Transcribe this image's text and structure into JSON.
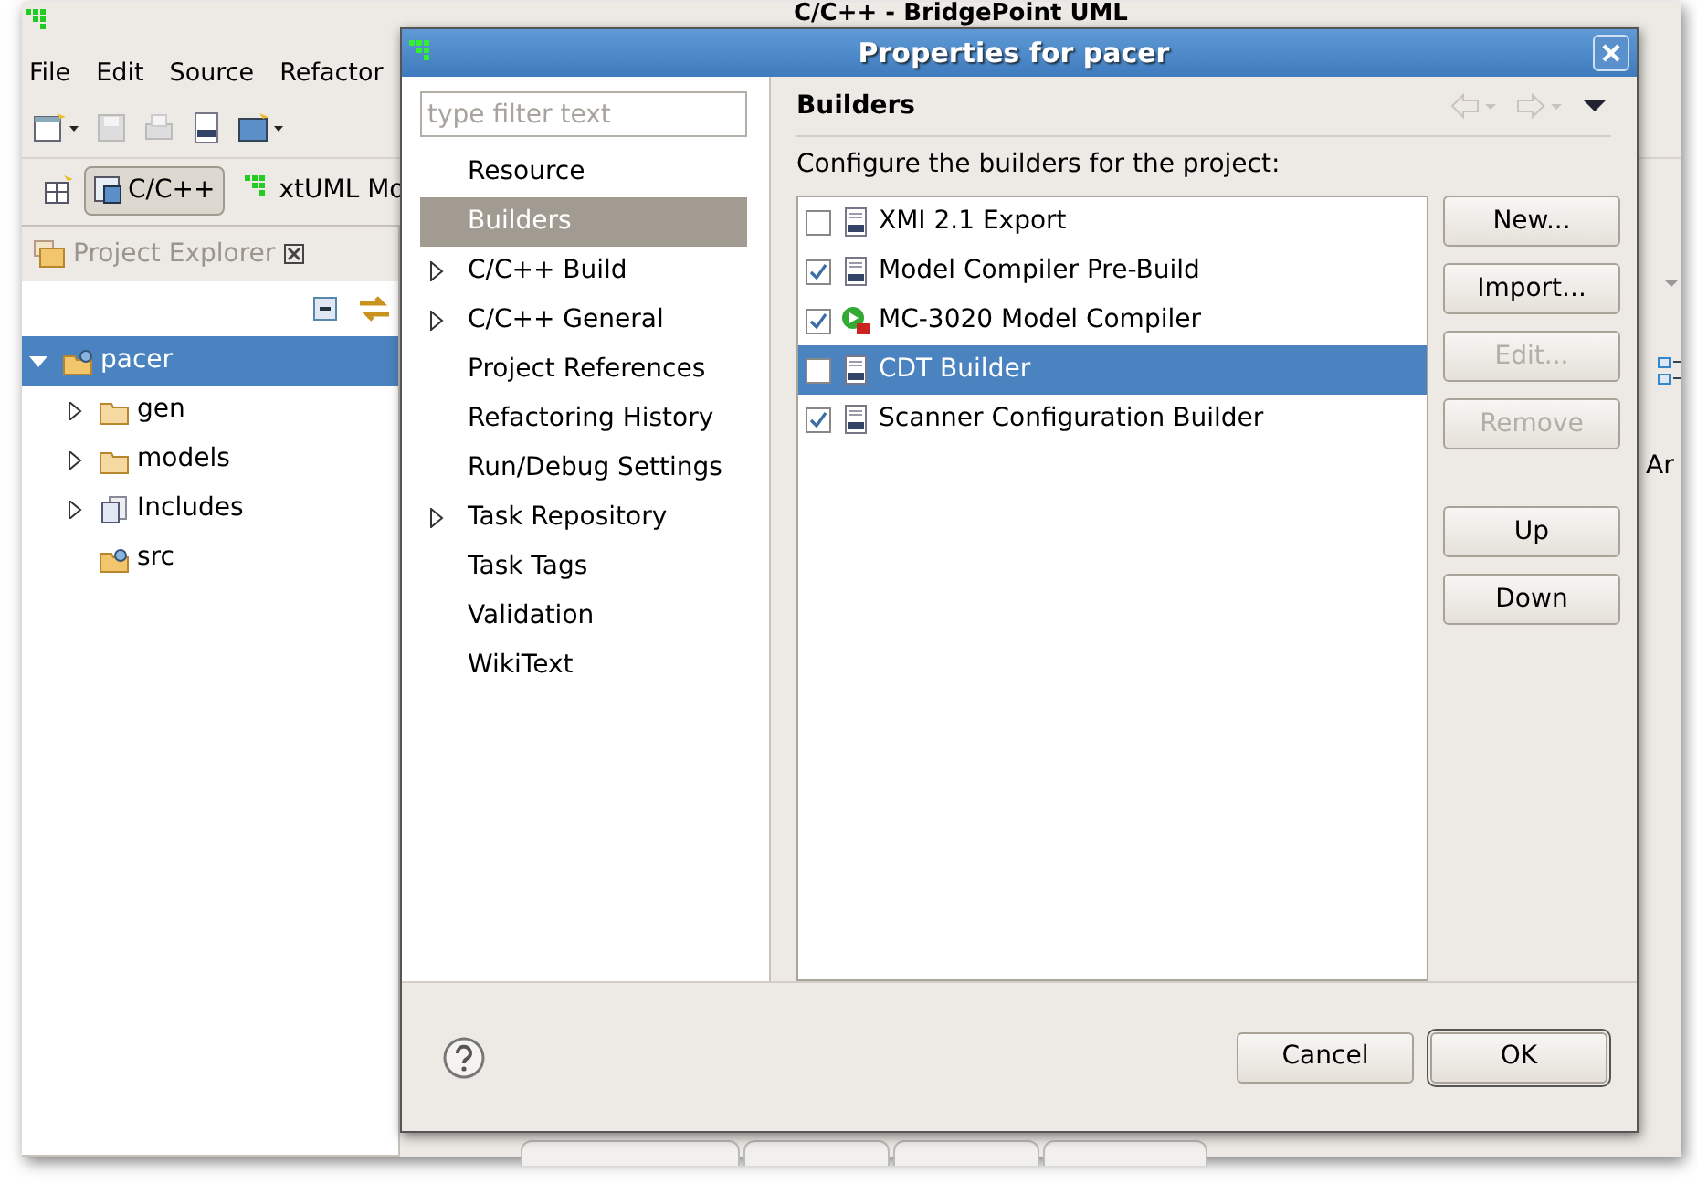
{
  "main_window": {
    "title": "C/C++ - BridgePoint UML",
    "menu": [
      "File",
      "Edit",
      "Source",
      "Refactor"
    ],
    "perspectives": [
      {
        "label": "C/C++",
        "selected": true
      },
      {
        "label": "xtUML Mo",
        "selected": false
      }
    ],
    "explorer": {
      "title": "Project Explorer",
      "tree": [
        {
          "label": "pacer",
          "kind": "project",
          "expanded": true,
          "selected": true,
          "children": [
            {
              "label": "gen",
              "kind": "folder",
              "expanded": false,
              "selected": false
            },
            {
              "label": "models",
              "kind": "folder",
              "expanded": false,
              "selected": false
            },
            {
              "label": "Includes",
              "kind": "includes",
              "expanded": false,
              "selected": false
            },
            {
              "label": "src",
              "kind": "source",
              "selected": false
            }
          ]
        }
      ]
    },
    "right_panel_text": "Ar"
  },
  "dialog": {
    "title": "Properties for pacer",
    "filter": {
      "placeholder": "type filter text"
    },
    "nav": [
      {
        "label": "Resource",
        "selected": false,
        "expandable": false
      },
      {
        "label": "Builders",
        "selected": true,
        "expandable": false
      },
      {
        "label": "C/C++ Build",
        "selected": false,
        "expandable": true
      },
      {
        "label": "C/C++ General",
        "selected": false,
        "expandable": true
      },
      {
        "label": "Project References",
        "selected": false,
        "expandable": false
      },
      {
        "label": "Refactoring History",
        "selected": false,
        "expandable": false
      },
      {
        "label": "Run/Debug Settings",
        "selected": false,
        "expandable": false
      },
      {
        "label": "Task Repository",
        "selected": false,
        "expandable": true
      },
      {
        "label": "Task Tags",
        "selected": false,
        "expandable": false
      },
      {
        "label": "Validation",
        "selected": false,
        "expandable": false
      },
      {
        "label": "WikiText",
        "selected": false,
        "expandable": false
      }
    ],
    "page_title": "Builders",
    "description": "Configure the builders for the project:",
    "builders": [
      {
        "label": "XMI 2.1 Export",
        "kind": "file",
        "checked": false,
        "selected": false
      },
      {
        "label": "Model Compiler Pre-Build",
        "kind": "file",
        "checked": true,
        "selected": false
      },
      {
        "label": "MC-3020 Model Compiler",
        "kind": "launch",
        "checked": true,
        "selected": false
      },
      {
        "label": "CDT Builder",
        "kind": "file",
        "checked": false,
        "selected": true
      },
      {
        "label": "Scanner Configuration Builder",
        "kind": "file",
        "checked": true,
        "selected": false
      }
    ],
    "side_buttons": [
      {
        "label": "New...",
        "disabled": false
      },
      {
        "label": "Import...",
        "disabled": false
      },
      {
        "label": "Edit...",
        "disabled": true
      },
      {
        "label": "Remove",
        "disabled": true
      }
    ],
    "move_buttons": [
      {
        "label": "Up",
        "disabled": false
      },
      {
        "label": "Down",
        "disabled": false
      }
    ],
    "footer_buttons": [
      {
        "label": "Cancel",
        "default": false
      },
      {
        "label": "OK",
        "default": true
      }
    ]
  }
}
